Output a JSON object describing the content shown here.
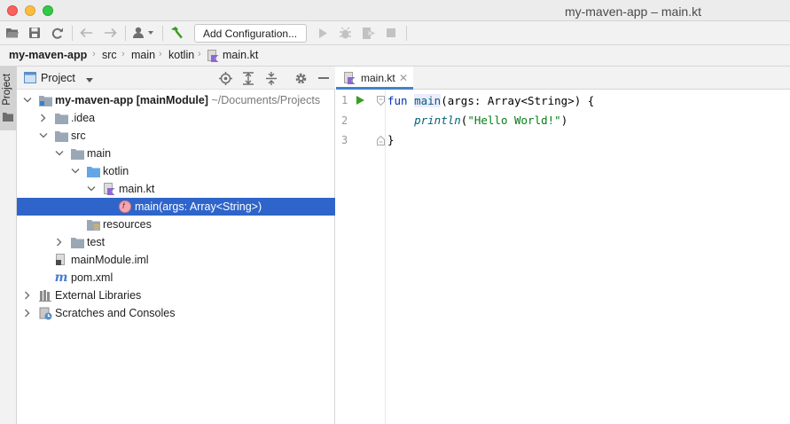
{
  "window": {
    "title": "my-maven-app – main.kt"
  },
  "toolbar": {
    "config_label": "Add Configuration..."
  },
  "navbar": {
    "crumbs": [
      "my-maven-app",
      "src",
      "main",
      "kotlin",
      "main.kt"
    ]
  },
  "stripe": {
    "label": "Project"
  },
  "project_panel": {
    "title": "Project",
    "tree": [
      {
        "label": "my-maven-app",
        "module": "[mainModule]",
        "path": "~/Documents/Projects"
      },
      {
        "label": ".idea"
      },
      {
        "label": "src"
      },
      {
        "label": "main"
      },
      {
        "label": "kotlin"
      },
      {
        "label": "main.kt"
      },
      {
        "label": "main(args: Array<String>)",
        "badge": "f"
      },
      {
        "label": "resources"
      },
      {
        "label": "test"
      },
      {
        "label": "mainModule.iml"
      },
      {
        "label": "pom.xml"
      },
      {
        "label": "External Libraries"
      },
      {
        "label": "Scratches and Consoles"
      }
    ]
  },
  "editor": {
    "tab_label": "main.kt",
    "line_numbers": [
      "1",
      "2",
      "3"
    ],
    "code": {
      "l1_kw": "fun",
      "l1_fn": "main",
      "l1_rest": "(args: Array<String>) {",
      "l2_fn": "println",
      "l2_open": "(",
      "l2_str": "\"Hello World!\"",
      "l2_close": ")",
      "l3": "}"
    }
  },
  "colors": {
    "selection": "#2f65ca",
    "tab_underline": "#4083c9",
    "run_green": "#3a9d23"
  }
}
